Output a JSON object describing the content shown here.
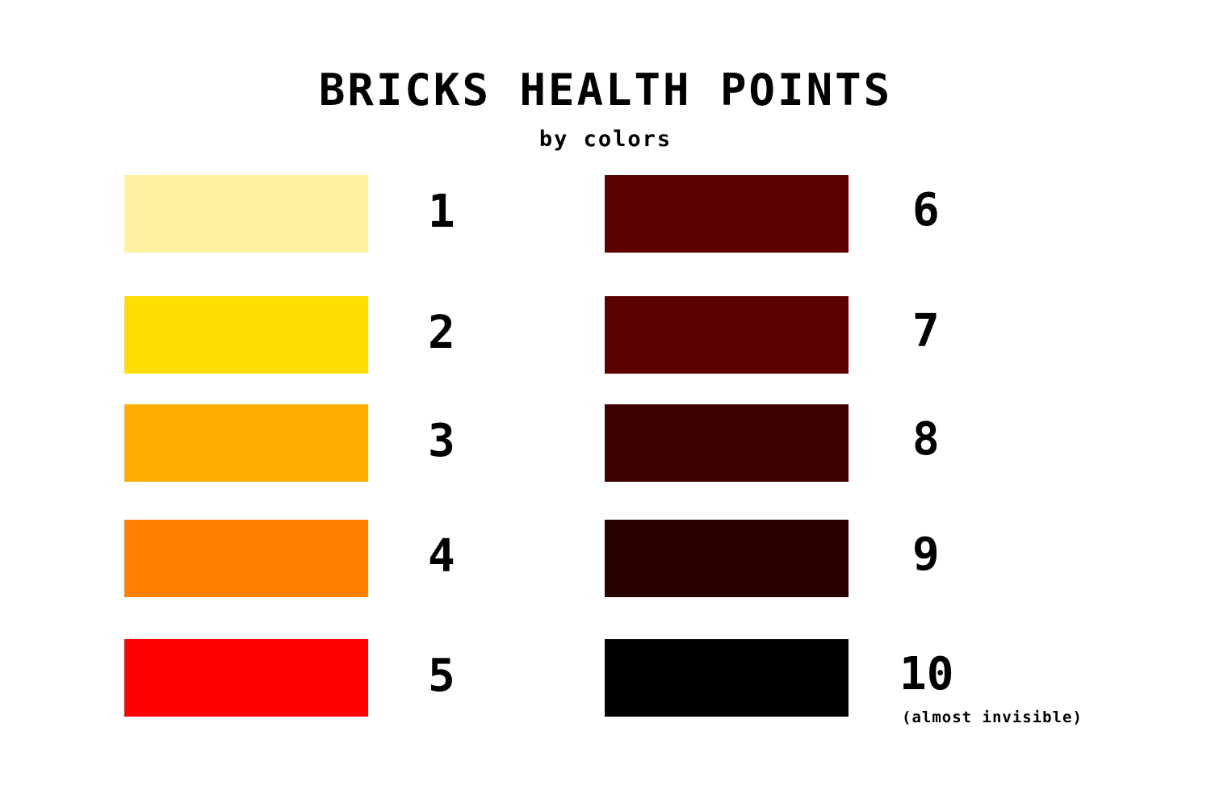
{
  "title": "BRICKS HEALTH POINTS",
  "subtitle": "by colors",
  "bricks": [
    {
      "hp": "1",
      "color": "#FFF0A0"
    },
    {
      "hp": "2",
      "color": "#FFDE00"
    },
    {
      "hp": "3",
      "color": "#FFAD00"
    },
    {
      "hp": "4",
      "color": "#FF7F00"
    },
    {
      "hp": "5",
      "color": "#FF0000"
    },
    {
      "hp": "6",
      "color": "#5C0000"
    },
    {
      "hp": "7",
      "color": "#5C0000"
    },
    {
      "hp": "8",
      "color": "#3D0000"
    },
    {
      "hp": "9",
      "color": "#270000"
    },
    {
      "hp": "10",
      "color": "#000000",
      "note": "(almost invisible)"
    }
  ]
}
